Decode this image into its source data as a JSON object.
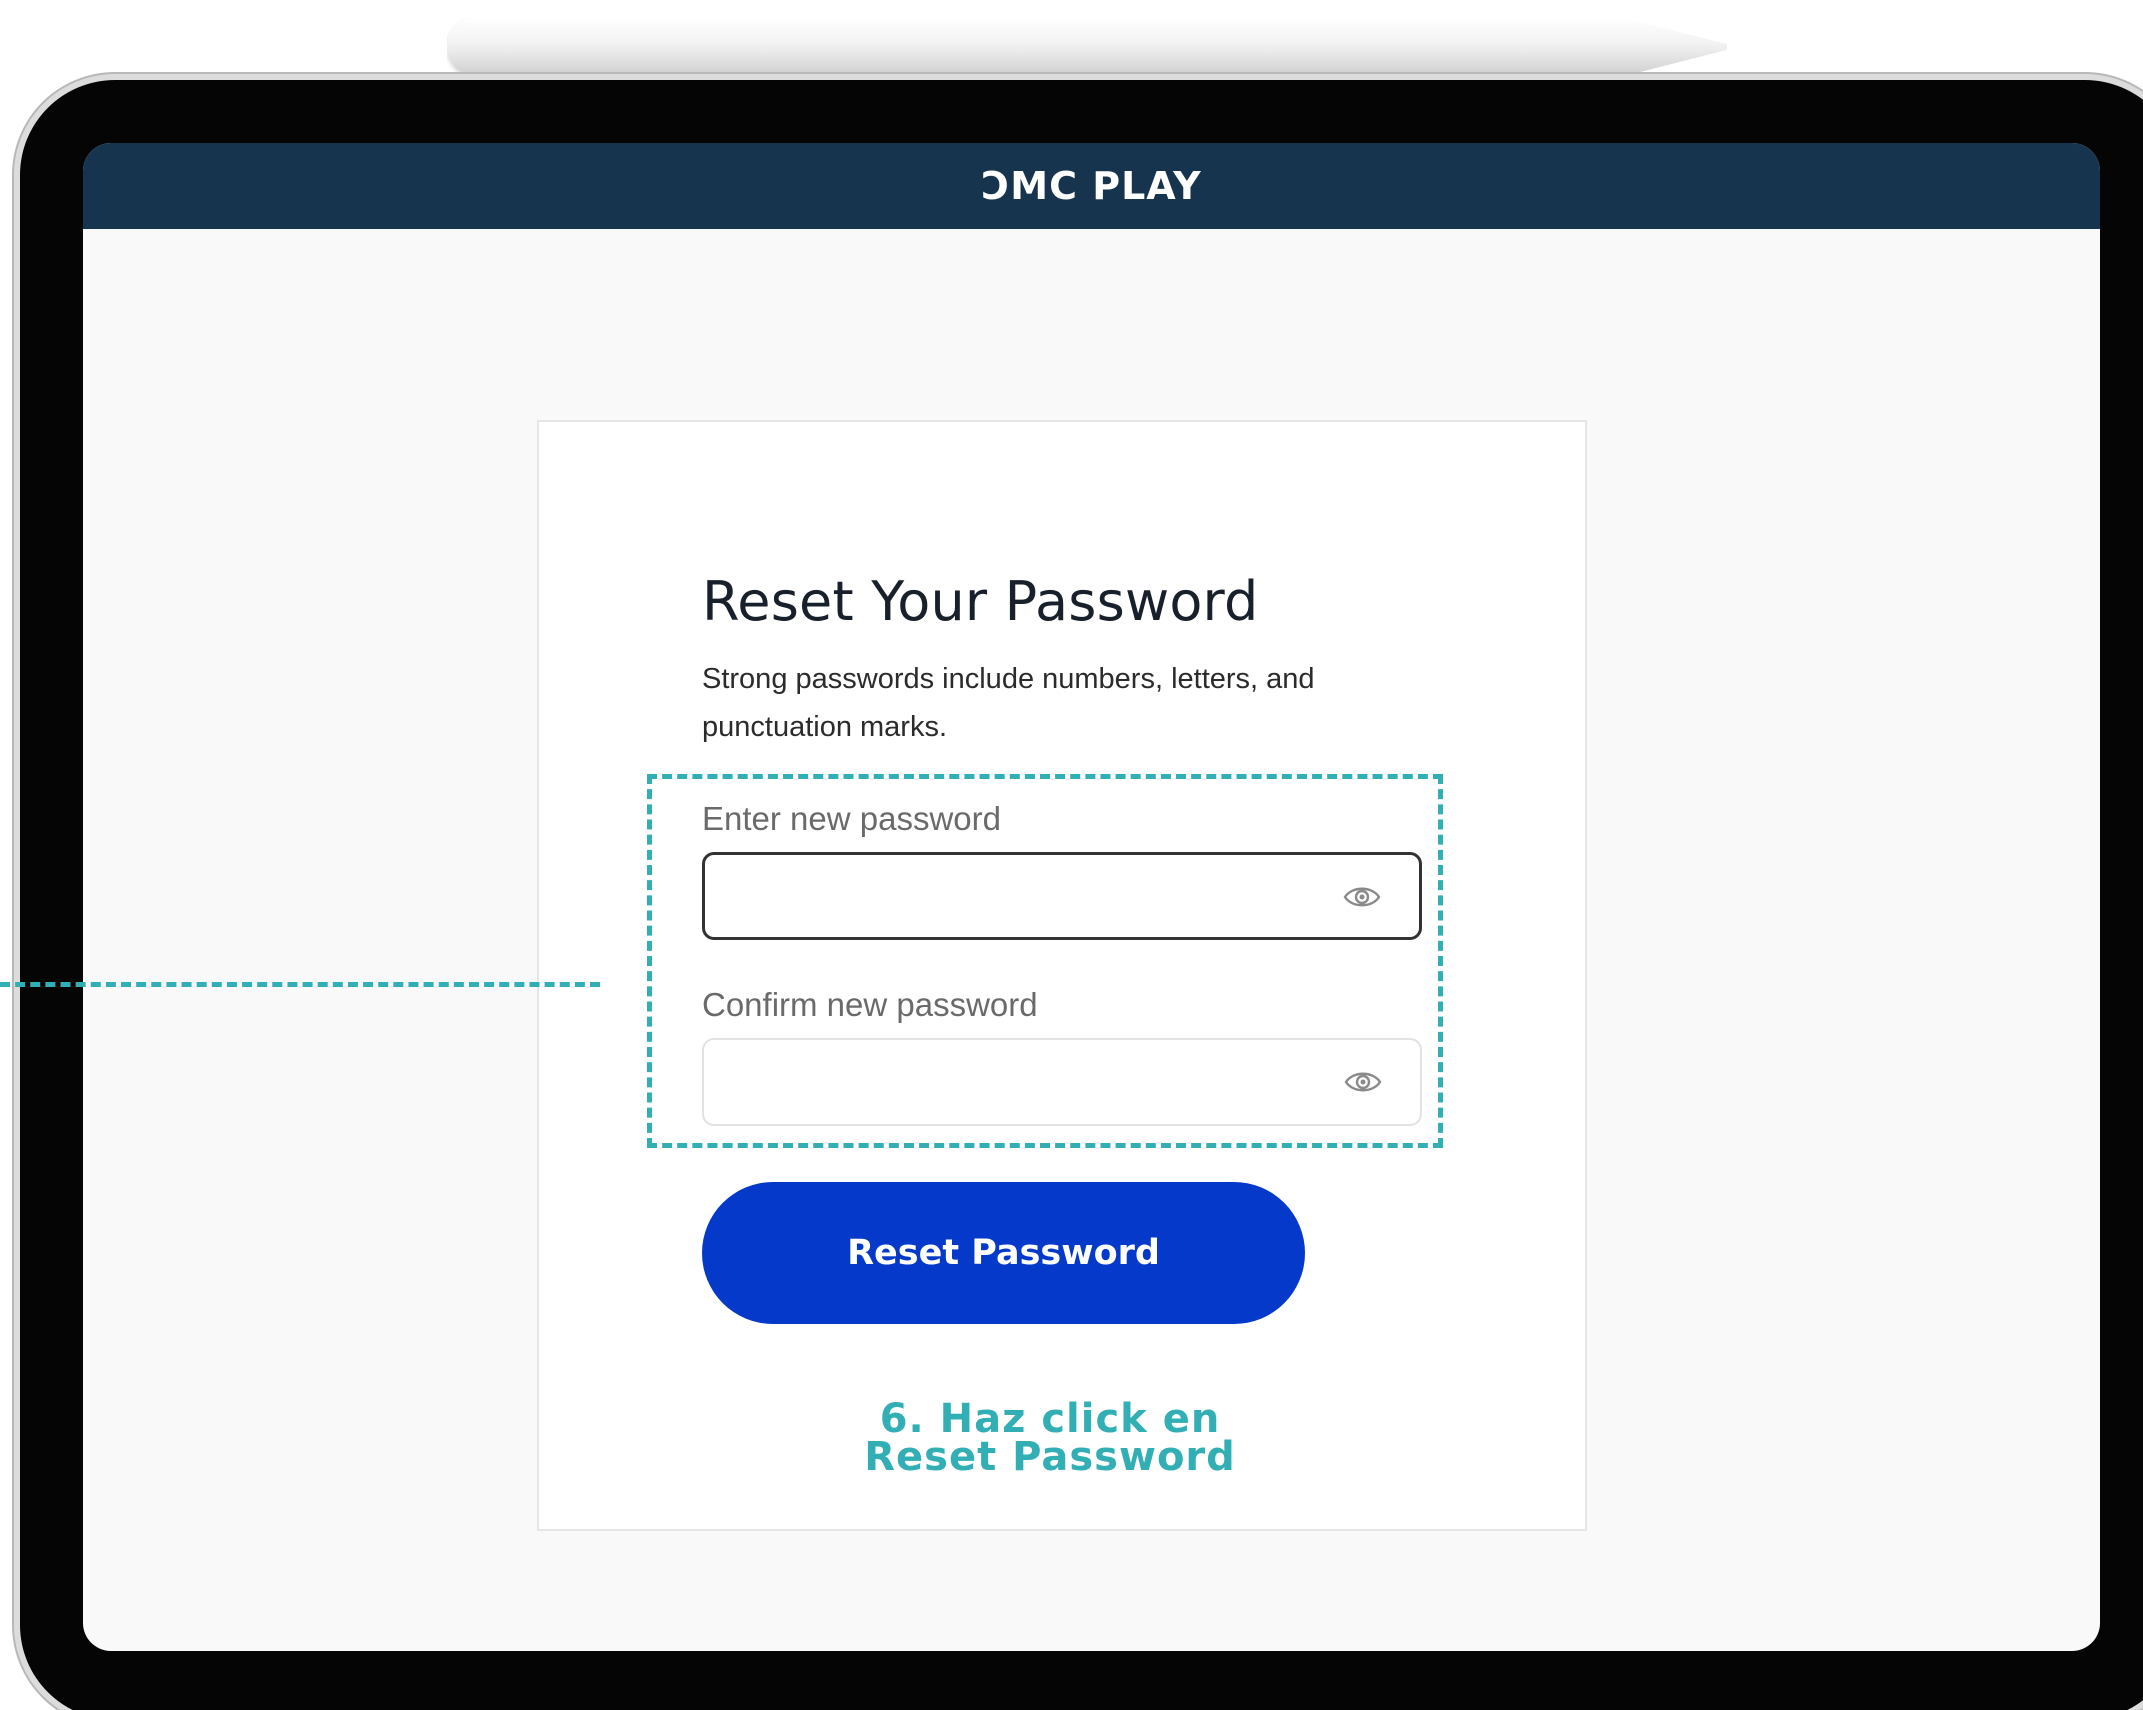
{
  "header": {
    "brand": "ƆMC PLAY"
  },
  "reset_form": {
    "title": "Reset Your Password",
    "subtitle": "Strong passwords include numbers, letters, and punctuation marks.",
    "new_password_label": "Enter new password",
    "new_password_value": "",
    "confirm_password_label": "Confirm new password",
    "confirm_password_value": "",
    "submit_label": "Reset Password"
  },
  "annotation": {
    "line1": "6. Haz click en",
    "line2": "Reset Password"
  },
  "icons": {
    "show_password": "eye-icon"
  },
  "colors": {
    "header_bg": "#17344f",
    "button_bg": "#0439c9",
    "annotation": "#32aeb5"
  }
}
